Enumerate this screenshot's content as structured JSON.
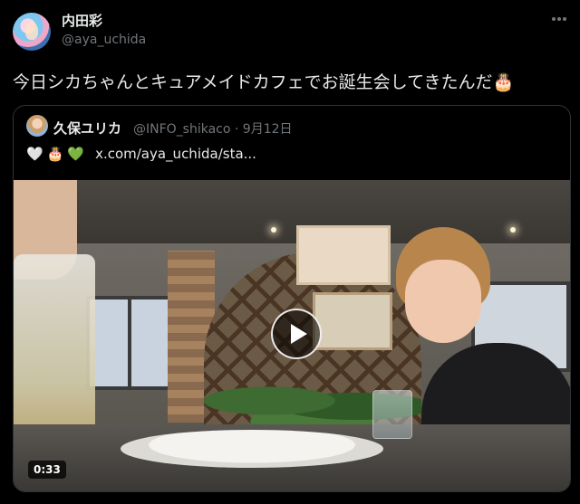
{
  "author": {
    "display_name": "内田彩",
    "handle": "@aya_uchida"
  },
  "tweet": {
    "text": "今日シカちゃんとキュアメイドカフェでお誕生会してきたんだ🎂"
  },
  "quote": {
    "display_name": "久保ユリカ",
    "handle": "@INFO_shikaco",
    "separator": " · ",
    "date": "9月12日",
    "emojis": [
      "🤍",
      "🎂",
      "💚"
    ],
    "link_text": "x.com/aya_uchida/sta..."
  },
  "video": {
    "duration": "0:33"
  },
  "icons": {
    "more": "more-horizontal-icon",
    "play": "play-icon"
  },
  "colors": {
    "background": "#000000",
    "text_primary": "#e7e9ea",
    "text_secondary": "#71767b",
    "border": "#2f3336"
  }
}
